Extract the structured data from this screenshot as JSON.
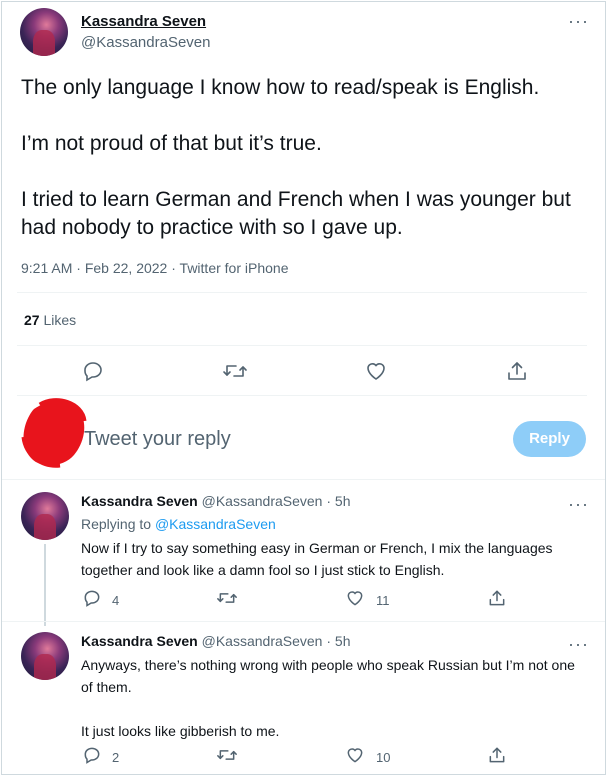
{
  "tweet": {
    "author_name": "Kassandra Seven",
    "author_handle": "@KassandraSeven",
    "text": "The only language I know how to read/speak is English.\n\nI’m not proud of that but it’s true.\n\nI tried to learn German and French when I was younger but had nobody to practice with so I gave up.",
    "time": "9:21 AM",
    "date": "Feb 22, 2022",
    "source": "Twitter for iPhone",
    "separator": "·",
    "likes_count": "27",
    "likes_label": "Likes",
    "more_icon": "more-icon"
  },
  "compose": {
    "placeholder": "Tweet your reply",
    "reply_button": "Reply",
    "reply_button_color": "#8ecdf8",
    "avatar_scribble_color": "#e8141c"
  },
  "replies": [
    {
      "author_name": "Kassandra Seven",
      "author_handle": "@KassandraSeven",
      "time": "· 5h",
      "replying_label": "Replying to",
      "replying_handle": "@KassandraSeven",
      "text": "Now if I try to say something easy in German or French, I mix the languages together and look like a damn fool so I just stick to English.",
      "reply_count": "4",
      "retweet_count": "",
      "like_count": "11"
    },
    {
      "author_name": "Kassandra Seven",
      "author_handle": "@KassandraSeven",
      "time": "· 5h",
      "text": "Anyways, there’s nothing wrong with people who speak Russian but I’m not one of them.\n\nIt just looks like gibberish to me.",
      "reply_count": "2",
      "retweet_count": "",
      "like_count": "10"
    }
  ],
  "colors": {
    "link": "#1d9bf0",
    "muted": "#536471",
    "divider": "#eff3f4",
    "thread_line": "#cfd9de"
  }
}
